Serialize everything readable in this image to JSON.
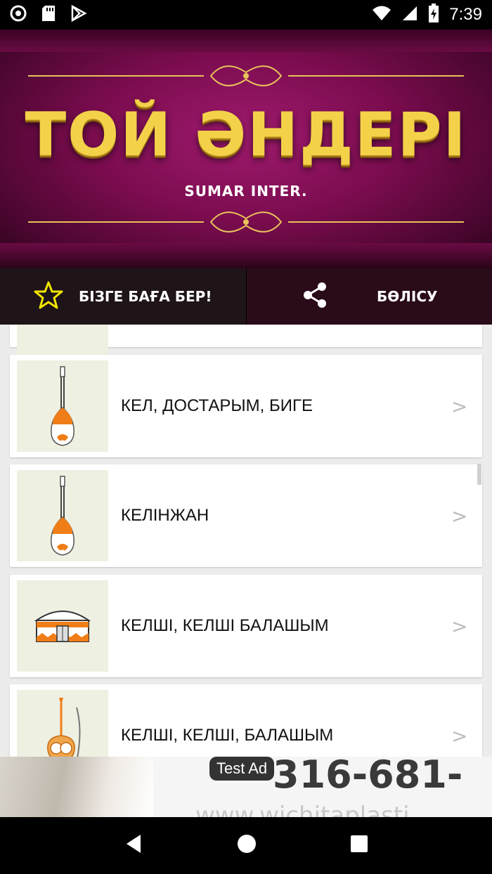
{
  "status_bar": {
    "time": "7:39",
    "icons": [
      "circle-icon",
      "sd-card-icon",
      "play-store-icon",
      "wifi-icon",
      "signal-icon",
      "battery-charging-icon"
    ]
  },
  "banner": {
    "title": "ТОЙ ӘНДЕРІ",
    "subtitle": "SUMAR INTER."
  },
  "actions": {
    "rate_label": "БІЗГЕ БАҒА БЕР!",
    "share_label": "БӨЛІСУ"
  },
  "songs": [
    {
      "title": "",
      "icon": "dombra-icon"
    },
    {
      "title": "КЕЛ, ДОСТАРЫМ, БИГЕ",
      "icon": "dombra-icon"
    },
    {
      "title": "КЕЛІНЖАН",
      "icon": "dombra-icon"
    },
    {
      "title": "КЕЛШІ, КЕЛШІ БАЛАШЫМ",
      "icon": "yurt-icon"
    },
    {
      "title": "КЕЛШІ, КЕЛШІ, БАЛАШЫМ",
      "icon": "kobyz-icon"
    }
  ],
  "chevron": ">",
  "ad": {
    "badge": "Test Ad",
    "phone": "316-681-",
    "url": "www.wichitaplasti"
  },
  "colors": {
    "banner": "#7a0c4e",
    "gold": "#f3d24a",
    "star": "#f2e500"
  }
}
